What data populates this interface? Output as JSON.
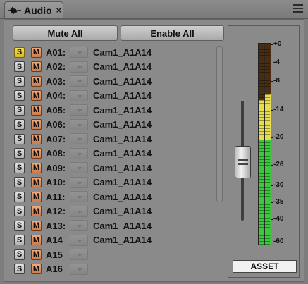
{
  "tab": {
    "title": "Audio",
    "close": "×",
    "icon": "waveform-icon"
  },
  "menu": {
    "icon": "hamburger-menu-icon"
  },
  "buttons": {
    "mute_all": "Mute All",
    "enable_all": "Enable All"
  },
  "tracks": [
    {
      "s": "S",
      "m": "M",
      "name": "A01:",
      "clip": "Cam1_A1A14",
      "solo": true
    },
    {
      "s": "S",
      "m": "M",
      "name": "A02:",
      "clip": "Cam1_A1A14",
      "solo": false
    },
    {
      "s": "S",
      "m": "M",
      "name": "A03:",
      "clip": "Cam1_A1A14",
      "solo": false
    },
    {
      "s": "S",
      "m": "M",
      "name": "A04:",
      "clip": "Cam1_A1A14",
      "solo": false
    },
    {
      "s": "S",
      "m": "M",
      "name": "A05:",
      "clip": "Cam1_A1A14",
      "solo": false
    },
    {
      "s": "S",
      "m": "M",
      "name": "A06:",
      "clip": "Cam1_A1A14",
      "solo": false
    },
    {
      "s": "S",
      "m": "M",
      "name": "A07:",
      "clip": "Cam1_A1A14",
      "solo": false
    },
    {
      "s": "S",
      "m": "M",
      "name": "A08:",
      "clip": "Cam1_A1A14",
      "solo": false
    },
    {
      "s": "S",
      "m": "M",
      "name": "A09:",
      "clip": "Cam1_A1A14",
      "solo": false
    },
    {
      "s": "S",
      "m": "M",
      "name": "A10:",
      "clip": "Cam1_A1A14",
      "solo": false
    },
    {
      "s": "S",
      "m": "M",
      "name": "A11:",
      "clip": "Cam1_A1A14",
      "solo": false
    },
    {
      "s": "S",
      "m": "M",
      "name": "A12:",
      "clip": "Cam1_A1A14",
      "solo": false
    },
    {
      "s": "S",
      "m": "M",
      "name": "A13:",
      "clip": "Cam1_A1A14",
      "solo": false
    },
    {
      "s": "S",
      "m": "M",
      "name": "A14",
      "clip": "Cam1_A1A14",
      "solo": false
    },
    {
      "s": "S",
      "m": "M",
      "name": "A15",
      "clip": "",
      "solo": false
    },
    {
      "s": "S",
      "m": "M",
      "name": "A16",
      "clip": "",
      "solo": false
    }
  ],
  "meter": {
    "scale": [
      "+0",
      "-4",
      "-8",
      "-14",
      "-20",
      "-26",
      "-30",
      "-35",
      "-40",
      "-60"
    ],
    "label": "ASSET",
    "colors": {
      "green": "#3cc83c",
      "yellow": "#e6dc50",
      "dark": "#4a2c10"
    }
  }
}
